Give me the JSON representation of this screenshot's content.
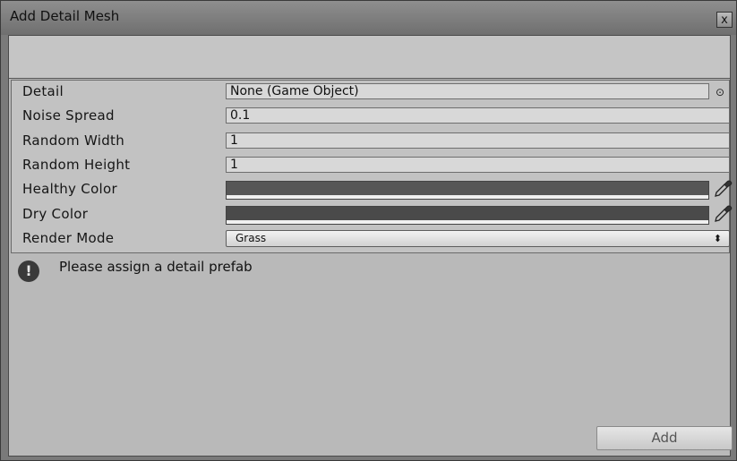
{
  "window": {
    "title": "Add Detail Mesh",
    "close_glyph": "x"
  },
  "properties": [
    {
      "label": "Detail",
      "value": "None (Game Object)"
    },
    {
      "label": "Noise Spread",
      "value": "0.1"
    },
    {
      "label": "Random Width",
      "value": "1"
    },
    {
      "label": "Random Height",
      "value": "1"
    },
    {
      "label": "Healthy Color",
      "color": "#565656"
    },
    {
      "label": "Dry Color",
      "color": "#4a4a4a"
    },
    {
      "label": "Render Mode",
      "value": "Grass"
    }
  ],
  "icons": {
    "object_picker": "target-circle-icon",
    "color_picker": "eyedropper-icon",
    "warning": "warning-icon",
    "dropdown": "up-down-arrow-icon"
  },
  "help": {
    "icon_glyph": "!",
    "message": "Please assign a detail prefab"
  },
  "actions": {
    "add_label": "Add"
  },
  "glyphs": {
    "picker": "⊙",
    "dropdown": "⬍"
  }
}
